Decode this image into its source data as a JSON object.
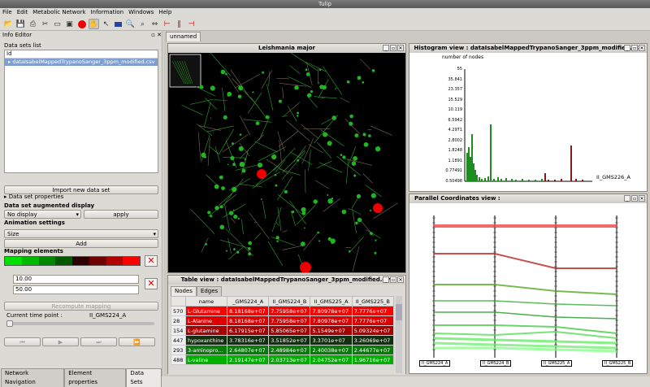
{
  "window_title": "Tulip",
  "menu": [
    "File",
    "Edit",
    "Metabolic Network",
    "Information",
    "Windows",
    "Help"
  ],
  "left": {
    "panel_title": "Info Editor",
    "datasets_label": "Data sets list",
    "id_header": "Id",
    "dataset_item": "dataIsabelMappedTrypanoSanger_3ppm_modified.csv",
    "import_btn": "Import new data set",
    "dataset_props": "Data set properties",
    "augmented_label": "Data set augmented display",
    "augmented_value": "No display",
    "apply_btn": "apply",
    "animation_label": "Animation settings",
    "animation_value": "Size",
    "add_btn": "Add",
    "mapping_label": "Mapping elements",
    "min_value": "10.00",
    "max_value": "50.00",
    "recompute_btn": "Recompute mapping",
    "time_label": "Current time point :",
    "time_value": "II_GMS224_A",
    "bottom_tabs": [
      "Network Navigation",
      "Element properties",
      "Data Sets"
    ],
    "gradient_colors": [
      "#00e000",
      "#00b800",
      "#008800",
      "#005800",
      "#2a0000",
      "#700000",
      "#b00000",
      "#ff0000"
    ]
  },
  "workspace_tab": "unnamed",
  "graph_view": {
    "title": "Leishmania major"
  },
  "histogram": {
    "title": "Histogram view : dataIsabelMappedTrypanoSanger_3ppm_modified.csv",
    "ylabel": "number of nodes",
    "xlabel": "II_GMS226_A",
    "yticks": [
      "55",
      "35.841",
      "23.357",
      "15.529",
      "10.119",
      "6.5942",
      "4.2971",
      "2.8002",
      "1.8248",
      "1.1891",
      "0.77491",
      "0.50498"
    ]
  },
  "parallel": {
    "title": "Parallel Coordinates view : dataIsabelMappedTrypanoSanger_3ppm_modified.csv",
    "axes": [
      "II_GMS224_A",
      "II_GMS224_B",
      "II_GMS225_A",
      "II_GMS225_B"
    ]
  },
  "table": {
    "title": "Table view : dataIsabelMappedTrypanoSanger_3ppm_modified.csv",
    "tabs": [
      "Nodes",
      "Edges"
    ],
    "headers": [
      "",
      "name",
      "_GMS224_A",
      "II_GMS224_B",
      "II_GMS225_A",
      "II_GMS225_B"
    ],
    "rows": [
      {
        "id": "570",
        "name": "L-Glutamine",
        "c1": "8.18168e+07",
        "c2": "7.75958e+07",
        "c3": "7.80978e+07",
        "c4": "7.7776e+07",
        "bg": "#ff0000"
      },
      {
        "id": "28",
        "name": "L-Alanine",
        "c1": "8.18168e+07",
        "c2": "7.75958e+07",
        "c3": "7.80978e+07",
        "c4": "7.7776e+07",
        "bg": "#dd0000"
      },
      {
        "id": "154",
        "name": "L-glutamine",
        "c1": "6.17915e+07",
        "c2": "5.85065e+07",
        "c3": "5.1549e+07",
        "c4": "5.09324e+07",
        "bg": "#a80000"
      },
      {
        "id": "447",
        "name": "hypoxanthine",
        "c1": "3.78316e+07",
        "c2": "3.51852e+07",
        "c3": "3.3701e+07",
        "c4": "3.26069e+07",
        "bg": "#103010"
      },
      {
        "id": "293",
        "name": "3-aminopro...",
        "c1": "2.64807e+07",
        "c2": "2.48984e+07",
        "c3": "2.40038e+07",
        "c4": "2.44677e+07",
        "bg": "#0a7a0a"
      },
      {
        "id": "488",
        "name": "L-valine",
        "c1": "2.19147e+07",
        "c2": "2.03713e+07",
        "c3": "2.04752e+07",
        "c4": "1.96716e+07",
        "bg": "#00b000"
      }
    ]
  }
}
